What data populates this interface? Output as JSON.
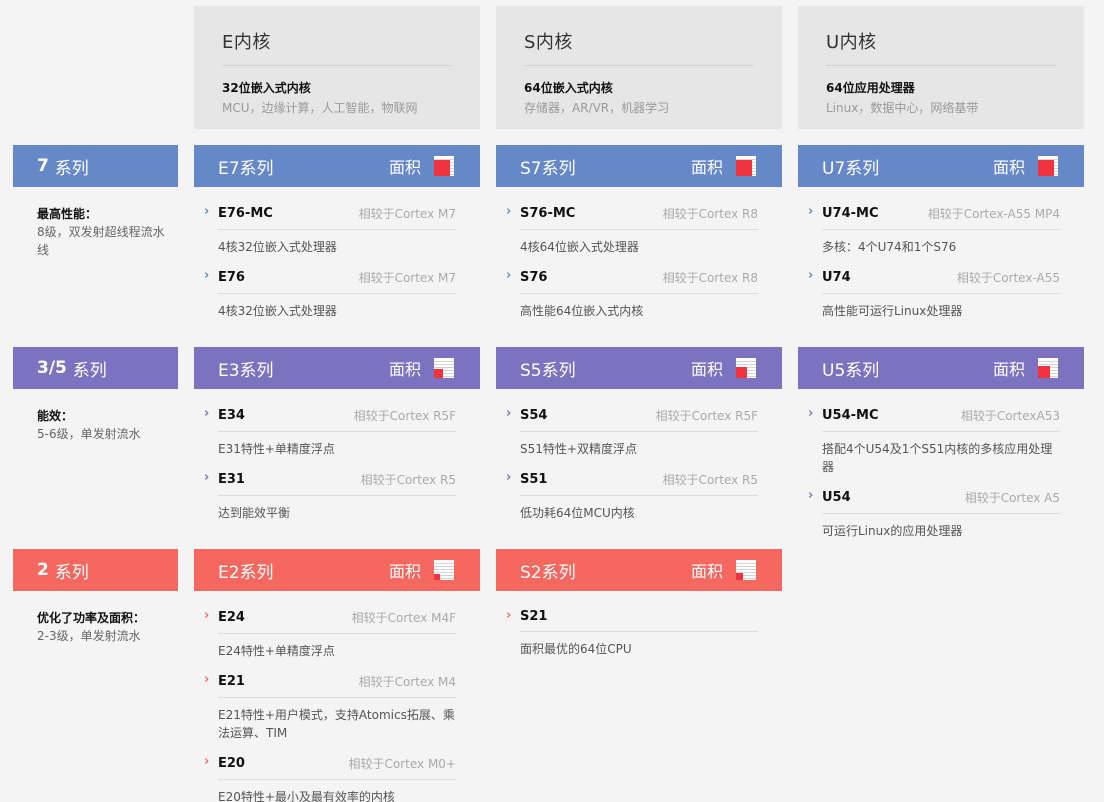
{
  "columns": [
    {
      "title": "E内核",
      "subtitle": "32位嵌入式内核",
      "applications": "MCU，边缘计算，人工智能，物联网"
    },
    {
      "title": "S内核",
      "subtitle": "64位嵌入式内核",
      "applications": "存储器，AR/VR，机器学习"
    },
    {
      "title": "U内核",
      "subtitle": "64位应用处理器",
      "applications": "Linux，数据中心，网络基带"
    }
  ],
  "area_label": "面积",
  "series": [
    {
      "num": "7",
      "suffix": "系列",
      "color": "#6688c9",
      "perf_title": "最高性能：",
      "perf_desc": "8级，双发射超线程流水线",
      "families": [
        {
          "name": "E7系列",
          "area_fraction": 0.8,
          "cores": [
            {
              "name": "E76-MC",
              "compare": "相较于Cortex M7",
              "info": "4核32位嵌入式处理器"
            },
            {
              "name": "E76",
              "compare": "相较于Cortex M7",
              "info": "4核32位嵌入式处理器"
            }
          ]
        },
        {
          "name": "S7系列",
          "area_fraction": 0.8,
          "cores": [
            {
              "name": "S76-MC",
              "compare": "相较于Cortex R8",
              "info": "4核64位嵌入式处理器"
            },
            {
              "name": "S76",
              "compare": "相较于Cortex R8",
              "info": "高性能64位嵌入式内核"
            }
          ]
        },
        {
          "name": "U7系列",
          "area_fraction": 0.8,
          "cores": [
            {
              "name": "U74-MC",
              "compare": "相较于Cortex-A55 MP4",
              "info": "多核：4个U74和1个S76"
            },
            {
              "name": "U74",
              "compare": "相较于Cortex-A55",
              "info": "高性能可运行Linux处理器"
            }
          ]
        }
      ]
    },
    {
      "num": "3/5",
      "suffix": "系列",
      "color": "#7d72c0",
      "perf_title": "能效：",
      "perf_desc": "5-6级，单发射流水",
      "families": [
        {
          "name": "E3系列",
          "area_fraction": 0.45,
          "cores": [
            {
              "name": "E34",
              "compare": "相较于Cortex R5F",
              "info": "E31特性+单精度浮点"
            },
            {
              "name": "E31",
              "compare": "相较于Cortex R5",
              "info": "达到能效平衡"
            }
          ]
        },
        {
          "name": "S5系列",
          "area_fraction": 0.55,
          "cores": [
            {
              "name": "S54",
              "compare": "相较于Cortex R5F",
              "info": "S51特性+双精度浮点"
            },
            {
              "name": "S51",
              "compare": "相较于Cortex R5",
              "info": "低功耗64位MCU内核"
            }
          ]
        },
        {
          "name": "U5系列",
          "area_fraction": 0.6,
          "cores": [
            {
              "name": "U54-MC",
              "compare": "相较于CortexA53",
              "info": "搭配4个U54及1个S51内核的多核应用处理器"
            },
            {
              "name": "U54",
              "compare": "相较于Cortex A5",
              "info": "可运行Linux的应用处理器"
            }
          ]
        }
      ]
    },
    {
      "num": "2",
      "suffix": "系列",
      "color": "#f4685f",
      "perf_title": "优化了功率及面积：",
      "perf_desc": "2-3级，单发射流水",
      "families": [
        {
          "name": "E2系列",
          "area_fraction": 0.3,
          "cores": [
            {
              "name": "E24",
              "compare": "相较于Cortex M4F",
              "info": "E24特性+单精度浮点"
            },
            {
              "name": "E21",
              "compare": "相较于Cortex M4",
              "info": "E21特性+用户模式，支持Atomics拓展、乘法运算、TIM"
            },
            {
              "name": "E20",
              "compare": "相较于Cortex M0+",
              "info": "E20特性+最小及最有效率的内核"
            }
          ]
        },
        {
          "name": "S2系列",
          "area_fraction": 0.35,
          "cores": [
            {
              "name": "S21",
              "compare": "",
              "info": "面积最优的64位CPU"
            }
          ]
        }
      ]
    }
  ]
}
